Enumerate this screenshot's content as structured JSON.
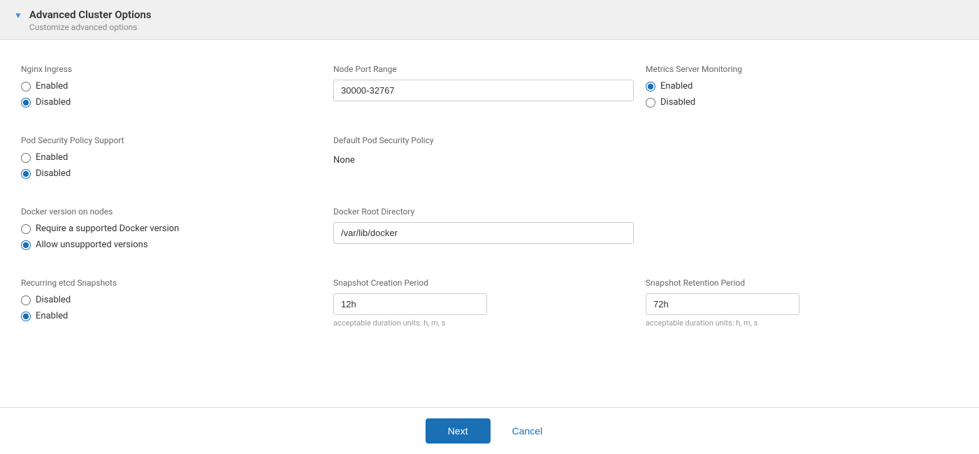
{
  "header": {
    "title": "Advanced Cluster Options",
    "subtitle": "Customize advanced options",
    "chevron": "▼"
  },
  "sections": {
    "nginx_ingress": {
      "label": "Nginx Ingress",
      "options": [
        {
          "id": "nginx-enabled",
          "label": "Enabled",
          "checked": false
        },
        {
          "id": "nginx-disabled",
          "label": "Disabled",
          "checked": true
        }
      ]
    },
    "node_port_range": {
      "label": "Node Port Range",
      "value": "30000-32767",
      "placeholder": "30000-32767"
    },
    "metrics_server": {
      "label": "Metrics Server Monitoring",
      "options": [
        {
          "id": "metrics-enabled",
          "label": "Enabled",
          "checked": true
        },
        {
          "id": "metrics-disabled",
          "label": "Disabled",
          "checked": false
        }
      ]
    },
    "pod_security_policy": {
      "label": "Pod Security Policy Support",
      "options": [
        {
          "id": "psp-enabled",
          "label": "Enabled",
          "checked": false
        },
        {
          "id": "psp-disabled",
          "label": "Disabled",
          "checked": true
        }
      ]
    },
    "default_pod_security": {
      "label": "Default Pod Security Policy",
      "value": "None"
    },
    "docker_version": {
      "label": "Docker version on nodes",
      "options": [
        {
          "id": "docker-supported",
          "label": "Require a supported Docker version",
          "checked": false
        },
        {
          "id": "docker-unsupported",
          "label": "Allow unsupported versions",
          "checked": true
        }
      ]
    },
    "docker_root": {
      "label": "Docker Root Directory",
      "value": "/var/lib/docker",
      "placeholder": "/var/lib/docker"
    },
    "recurring_etcd": {
      "label": "Recurring etcd Snapshots",
      "options": [
        {
          "id": "etcd-disabled",
          "label": "Disabled",
          "checked": false
        },
        {
          "id": "etcd-enabled",
          "label": "Enabled",
          "checked": true
        }
      ]
    },
    "snapshot_creation": {
      "label": "Snapshot Creation Period",
      "value": "12h",
      "hint": "acceptable duration units: h, m, s"
    },
    "snapshot_retention": {
      "label": "Snapshot Retention Period",
      "value": "72h",
      "hint": "acceptable duration units: h, m, s"
    }
  },
  "footer": {
    "next_label": "Next",
    "cancel_label": "Cancel"
  }
}
